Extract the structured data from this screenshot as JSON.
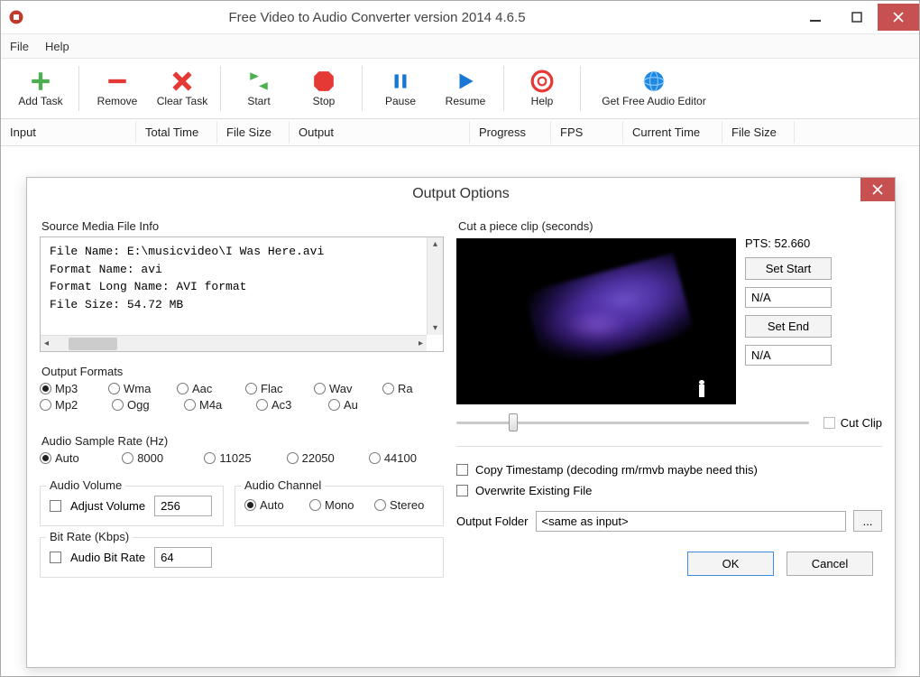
{
  "window": {
    "title": "Free Video to Audio Converter version 2014  4.6.5"
  },
  "menu": {
    "file": "File",
    "help": "Help"
  },
  "toolbar": {
    "add_task": "Add Task",
    "remove": "Remove",
    "clear_task": "Clear Task",
    "start": "Start",
    "stop": "Stop",
    "pause": "Pause",
    "resume": "Resume",
    "help": "Help",
    "editor": "Get Free Audio Editor"
  },
  "columns": {
    "input": "Input",
    "total_time": "Total Time",
    "file_size": "File Size",
    "output": "Output",
    "progress": "Progress",
    "fps": "FPS",
    "current_time": "Current Time",
    "file_size2": "File Size"
  },
  "dialog": {
    "title": "Output Options",
    "source_label": "Source Media File Info",
    "source_info": "File Name: E:\\musicvideo\\I Was Here.avi\nFormat Name: avi\nFormat Long Name: AVI format\nFile Size: 54.72 MB",
    "formats_label": "Output Formats",
    "formats_row1": [
      "Mp3",
      "Wma",
      "Aac",
      "Flac",
      "Wav",
      "Ra"
    ],
    "formats_row2": [
      "Mp2",
      "Ogg",
      "M4a",
      "Ac3",
      "Au"
    ],
    "formats_selected": "Mp3",
    "sample_rate_label": "Audio Sample Rate (Hz)",
    "sample_rates": [
      "Auto",
      "8000",
      "11025",
      "22050",
      "44100"
    ],
    "sample_rate_selected": "Auto",
    "volume_group": "Audio Volume",
    "adjust_volume": "Adjust Volume",
    "volume_value": "256",
    "channel_group": "Audio Channel",
    "channels": [
      "Auto",
      "Mono",
      "Stereo"
    ],
    "channel_selected": "Auto",
    "bitrate_group": "Bit Rate (Kbps)",
    "bitrate_label": "Audio Bit Rate",
    "bitrate_value": "64",
    "cut_label": "Cut a piece clip (seconds)",
    "pts": "PTS: 52.660",
    "set_start": "Set Start",
    "start_val": "N/A",
    "set_end": "Set End",
    "end_val": "N/A",
    "cut_clip": "Cut Clip",
    "copy_ts": "Copy Timestamp (decoding rm/rmvb maybe need this)",
    "overwrite": "Overwrite Existing File",
    "output_folder_label": "Output Folder",
    "output_folder_value": "<same as input>",
    "browse": "...",
    "ok": "OK",
    "cancel": "Cancel"
  }
}
